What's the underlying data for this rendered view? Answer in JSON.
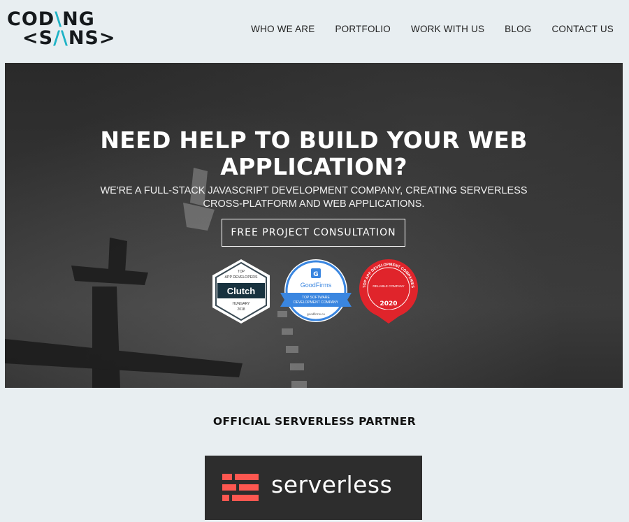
{
  "logo": {
    "line1_a": "COD",
    "line1_accent": "\\",
    "line1_b": "NG",
    "line2_a": "<S",
    "line2_accent": "/\\",
    "line2_b": "NS>"
  },
  "nav": {
    "items": [
      "WHO WE ARE",
      "PORTFOLIO",
      "WORK WITH US",
      "BLOG",
      "CONTACT US"
    ]
  },
  "hero": {
    "title_line1": "NEED HELP TO BUILD YOUR WEB",
    "title_line2": "APPLICATION?",
    "subtitle_line1": "WE'RE A FULL-STACK JAVASCRIPT DEVELOPMENT COMPANY, CREATING SERVERLESS",
    "subtitle_line2": "CROSS-PLATFORM AND WEB APPLICATIONS.",
    "cta_label": "FREE PROJECT CONSULTATION"
  },
  "badges": {
    "clutch": {
      "top": "TOP",
      "line": "APP DEVELOPERS",
      "name": "Clutch",
      "region": "HUNGARY",
      "year": "2018"
    },
    "goodfirms": {
      "name": "GoodFirms",
      "ribbon1": "TOP SOFTWARE",
      "ribbon2": "DEVELOPMENT COMPANY",
      "site": "goodfirms.co"
    },
    "topapp": {
      "arc": "TOP APP DEVELOPMENT COMPANIES",
      "inner": "RELIABLE COMPANY",
      "year": "2020"
    }
  },
  "partner": {
    "title": "OFFICIAL SERVERLESS PARTNER",
    "logo_text": "serverless"
  },
  "colors": {
    "page_bg": "#e8eef1",
    "logo_accent": "#1fb3c6",
    "serverless_red": "#fd5750",
    "goodfirms_blue": "#3a86e0",
    "topapp_red": "#e0242b"
  }
}
